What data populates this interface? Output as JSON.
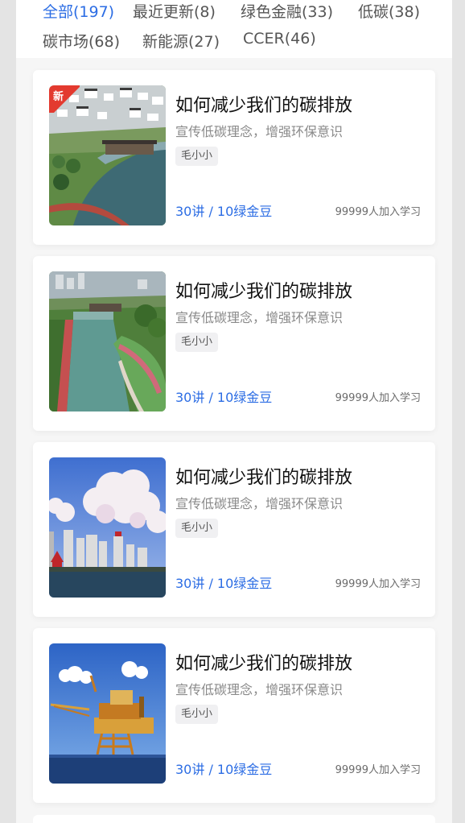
{
  "filters": [
    {
      "label": "全部(197)",
      "active": true
    },
    {
      "label": "最近更新(8)",
      "active": false
    },
    {
      "label": "绿色金融(33)",
      "active": false
    },
    {
      "label": "低碳(38)",
      "active": false
    },
    {
      "label": "碳市场(68)",
      "active": false
    },
    {
      "label": "新能源(27)",
      "active": false
    },
    {
      "label": "CCER(46)",
      "active": false
    }
  ],
  "courses": [
    {
      "title": "如何减少我们的碳排放",
      "subtitle": "宣传低碳理念，增强环保意识",
      "tag": "毛小小",
      "meta": "30讲 / 10绿金豆",
      "learners": "99999人加入学习",
      "badge": "新",
      "image": "town-canal-icon"
    },
    {
      "title": "如何减少我们的碳排放",
      "subtitle": "宣传低碳理念，增强环保意识",
      "tag": "毛小小",
      "meta": "30讲 / 10绿金豆",
      "learners": "99999人加入学习",
      "image": "river-park-icon"
    },
    {
      "title": "如何减少我们的碳排放",
      "subtitle": "宣传低碳理念，增强环保意识",
      "tag": "毛小小",
      "meta": "30讲 / 10绿金豆",
      "learners": "99999人加入学习",
      "image": "city-skyline-icon"
    },
    {
      "title": "如何减少我们的碳排放",
      "subtitle": "宣传低碳理念，增强环保意识",
      "tag": "毛小小",
      "meta": "30讲 / 10绿金豆",
      "learners": "99999人加入学习",
      "image": "oil-platform-icon"
    }
  ],
  "colors": {
    "accent": "#2c6de4",
    "badge": "#e33a2f"
  }
}
